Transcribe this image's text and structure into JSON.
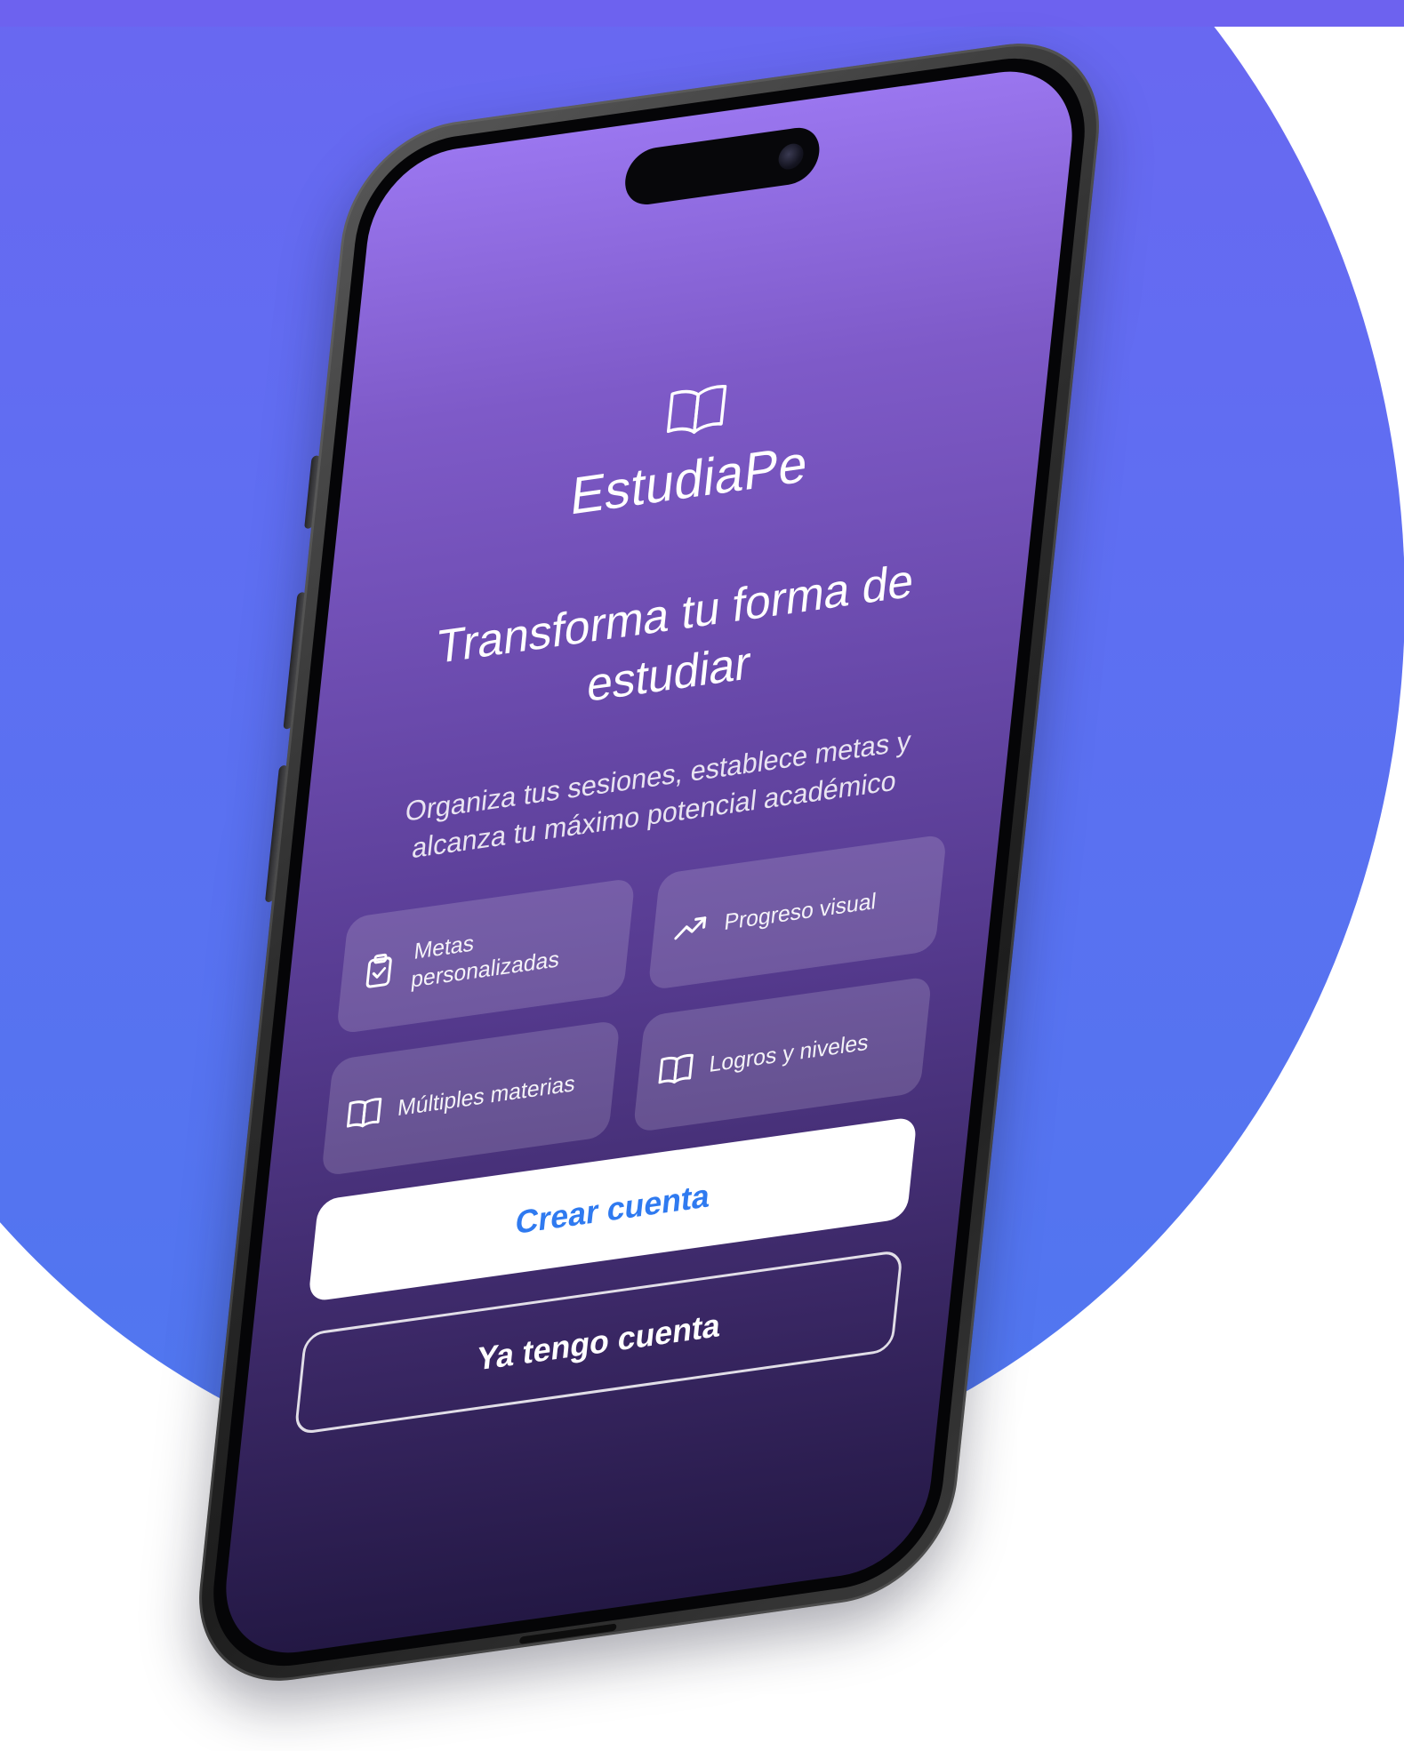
{
  "app": {
    "name": "EstudiaPe",
    "logo_icon": "open-book-icon"
  },
  "hero": {
    "headline": "Transforma tu forma de estudiar",
    "subtitle": "Organiza tus sesiones, establece metas y alcanza tu máximo potencial académico"
  },
  "features": [
    {
      "label": "Metas personalizadas",
      "icon": "clipboard-check-icon"
    },
    {
      "label": "Progreso visual",
      "icon": "trending-up-icon"
    },
    {
      "label": "Múltiples materias",
      "icon": "open-book-icon"
    },
    {
      "label": "Logros y niveles",
      "icon": "open-book-icon"
    }
  ],
  "actions": {
    "primary_label": "Crear cuenta",
    "secondary_label": "Ya tengo cuenta"
  },
  "colors": {
    "background_blob": "#6366f1",
    "screen_top": "#9a76ef",
    "screen_bottom": "#231844",
    "primary_button_text": "#2f7af0",
    "primary_button_bg": "#ffffff"
  }
}
